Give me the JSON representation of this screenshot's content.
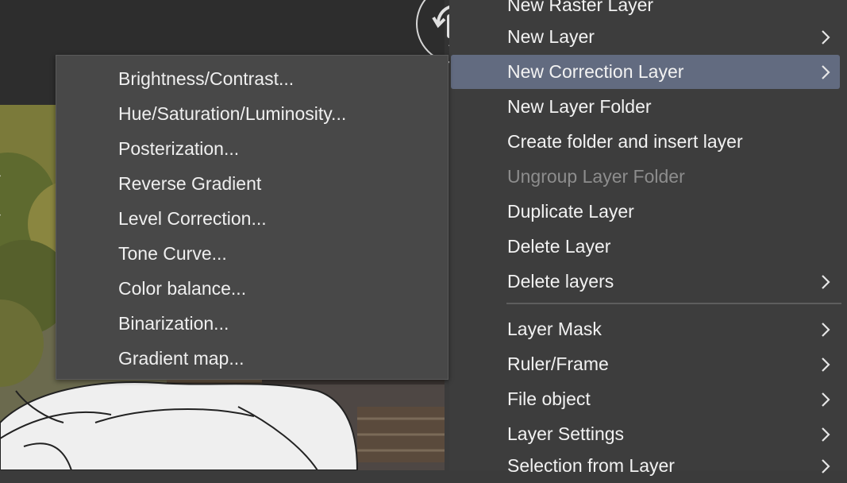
{
  "main_menu": {
    "items": [
      {
        "label": "New Raster Layer",
        "submenu": false,
        "state": "normal"
      },
      {
        "label": "New Layer",
        "submenu": true,
        "state": "normal"
      },
      {
        "label": "New Correction Layer",
        "submenu": true,
        "state": "active"
      },
      {
        "label": "New Layer Folder",
        "submenu": false,
        "state": "normal"
      },
      {
        "label": "Create folder and insert layer",
        "submenu": false,
        "state": "normal"
      },
      {
        "label": "Ungroup Layer Folder",
        "submenu": false,
        "state": "disabled"
      },
      {
        "label": "Duplicate Layer",
        "submenu": false,
        "state": "normal"
      },
      {
        "label": "Delete Layer",
        "submenu": false,
        "state": "normal"
      },
      {
        "label": "Delete layers",
        "submenu": true,
        "state": "normal"
      },
      {
        "label": "Layer Mask",
        "submenu": true,
        "state": "normal"
      },
      {
        "label": "Ruler/Frame",
        "submenu": true,
        "state": "normal"
      },
      {
        "label": "File object",
        "submenu": true,
        "state": "normal"
      },
      {
        "label": "Layer Settings",
        "submenu": true,
        "state": "normal"
      },
      {
        "label": "Selection from Layer",
        "submenu": true,
        "state": "normal"
      }
    ]
  },
  "submenu": {
    "items": [
      {
        "label": "Brightness/Contrast..."
      },
      {
        "label": "Hue/Saturation/Luminosity..."
      },
      {
        "label": "Posterization..."
      },
      {
        "label": "Reverse Gradient"
      },
      {
        "label": "Level Correction..."
      },
      {
        "label": "Tone Curve..."
      },
      {
        "label": "Color balance..."
      },
      {
        "label": "Binarization..."
      },
      {
        "label": "Gradient map..."
      }
    ]
  },
  "rotate_button": {
    "icon": "rotate-canvas-icon"
  },
  "colors": {
    "menu_bg": "#3d3d3d",
    "submenu_bg": "#484848",
    "highlight": "#626b80",
    "text": "#f2f2f2",
    "disabled_text": "#8d8d8d"
  }
}
